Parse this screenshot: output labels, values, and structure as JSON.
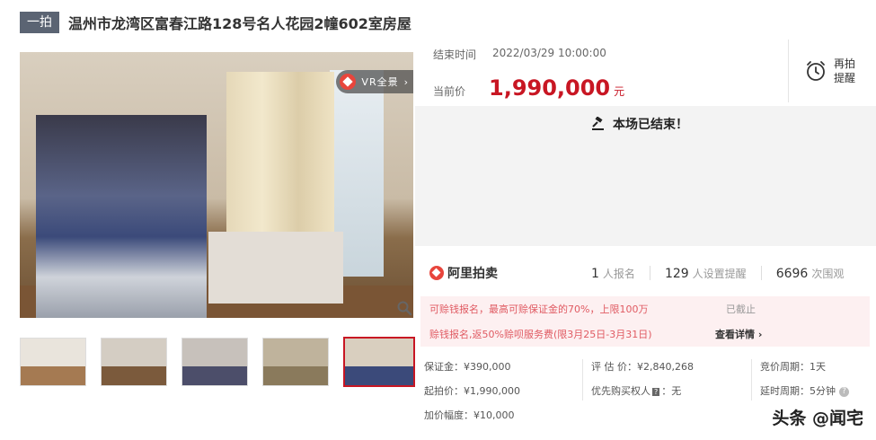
{
  "header": {
    "tag": "一拍",
    "title": "温州市龙湾区富春江路128号名人花园2幢602室房屋"
  },
  "gallery": {
    "vr_label": "VR全景",
    "vr_chevron": "›",
    "thumbnail_count": 5,
    "active_thumbnail": 5
  },
  "auction": {
    "end_time_label": "结束时间",
    "end_time": "2022/03/29 10:00:00",
    "price_label": "当前价",
    "price": "1,990,000",
    "price_unit": "元",
    "remind_line1": "再拍",
    "remind_line2": "提醒",
    "status": "本场已结束！"
  },
  "stats": {
    "logo": "阿里拍卖",
    "signup_count": "1",
    "signup_label": "人报名",
    "reminder_count": "129",
    "reminder_label": "人设置提醒",
    "views_count": "6696",
    "views_label": "次围观"
  },
  "promo": {
    "line1": "可赊钱报名，最高可赊保证金的70%，上限100万",
    "line1_status": "已截止",
    "line2": "赊钱报名,返50%赊呗服务费(限3月25日-3月31日)",
    "line2_link": "查看详情 ›"
  },
  "details": {
    "deposit": "保证金：¥390,000",
    "appraisal": "评 估 价：¥2,840,268",
    "cycle": "竞价周期：1天",
    "start_price": "起拍价：¥1,990,000",
    "priority_prefix": "优先购买权人",
    "priority_tag": "?",
    "priority_value": "：无",
    "delay": "延时周期：5分钟",
    "increment": "加价幅度：¥10,000"
  },
  "watermark": "头条 @闻宅",
  "colors": {
    "accent_red": "#c81623",
    "tag_bg": "#5b6473",
    "promo_bg": "#fdf0f1",
    "promo_text": "#e05a62"
  }
}
